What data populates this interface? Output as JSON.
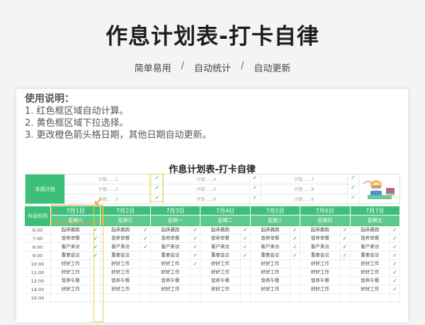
{
  "hero": {
    "title": "作息计划表-打卡自律",
    "subs": [
      "简单易用",
      "自动统计",
      "自动更新"
    ],
    "sep": "/"
  },
  "notes": {
    "head": "使用说明：",
    "lines": [
      "1. 红色框区域自动计算。",
      "2. 黄色框区域下拉选择。",
      "3. 更改橙色箭头格日期，其他日期自动更新。"
    ]
  },
  "planner": {
    "title": "作息计划表-打卡自律",
    "week_label": "本周计划",
    "plans": [
      [
        "计划……1",
        "计划……4",
        "计划……7"
      ],
      [
        "计划……2",
        "计划……5",
        "计划……8"
      ],
      [
        "计划……3",
        "计划……6",
        "计划……9"
      ]
    ],
    "checks": [
      [
        "✓",
        "✓",
        "✓"
      ],
      [
        "✓",
        "✓",
        "✓"
      ],
      [
        "✓",
        "✓",
        "✓"
      ]
    ],
    "time_label": "作息时间",
    "days": [
      {
        "d": "7月1日",
        "w": "星期六"
      },
      {
        "d": "7月2日",
        "w": "星期日"
      },
      {
        "d": "7月3日",
        "w": "星期一"
      },
      {
        "d": "7月4日",
        "w": "星期二"
      },
      {
        "d": "7月5日",
        "w": "星期三"
      },
      {
        "d": "7月6日",
        "w": "星期四"
      },
      {
        "d": "7月7日",
        "w": "星期五"
      }
    ],
    "rows": [
      {
        "t": "6:00",
        "a": "起床晨跑",
        "c": [
          "✓",
          "✓",
          "✓",
          "✓",
          "✓",
          "✓",
          "✓"
        ]
      },
      {
        "t": "7:00",
        "a": "营养早餐",
        "c": [
          "✓",
          "✓",
          "✓",
          "✓",
          "✓",
          "✓",
          "✓"
        ]
      },
      {
        "t": "8:00",
        "a": "客户来访",
        "c": [
          "✓",
          "✓",
          "✓",
          "✓",
          "✓",
          "✓",
          "✓"
        ]
      },
      {
        "t": "9:00",
        "a": "重要会议",
        "c": [
          "✓",
          "",
          "✓",
          "✓",
          "✓",
          "✓",
          "✓"
        ]
      },
      {
        "t": "10:00",
        "a": "好好工作",
        "c": [
          "",
          "",
          "✓",
          "",
          "",
          "",
          "✓"
        ]
      },
      {
        "t": "11:00",
        "a": "好好工作",
        "c": [
          "",
          "",
          "",
          "",
          "",
          "",
          "✓"
        ]
      },
      {
        "t": "12:00",
        "a": "营养午餐",
        "c": [
          "",
          "",
          "",
          "",
          "",
          "",
          "✓"
        ]
      },
      {
        "t": "14:00",
        "a": "好好工作",
        "c": [
          "",
          "",
          "",
          "",
          "",
          "",
          "✓"
        ]
      },
      {
        "t": "16:00",
        "a": "",
        "c": [
          "",
          "",
          "",
          "",
          "",
          "",
          ""
        ]
      }
    ]
  },
  "colors": {
    "green": "#3dbf79",
    "yellow": "#f1d33c",
    "orange": "#f39a3a"
  }
}
